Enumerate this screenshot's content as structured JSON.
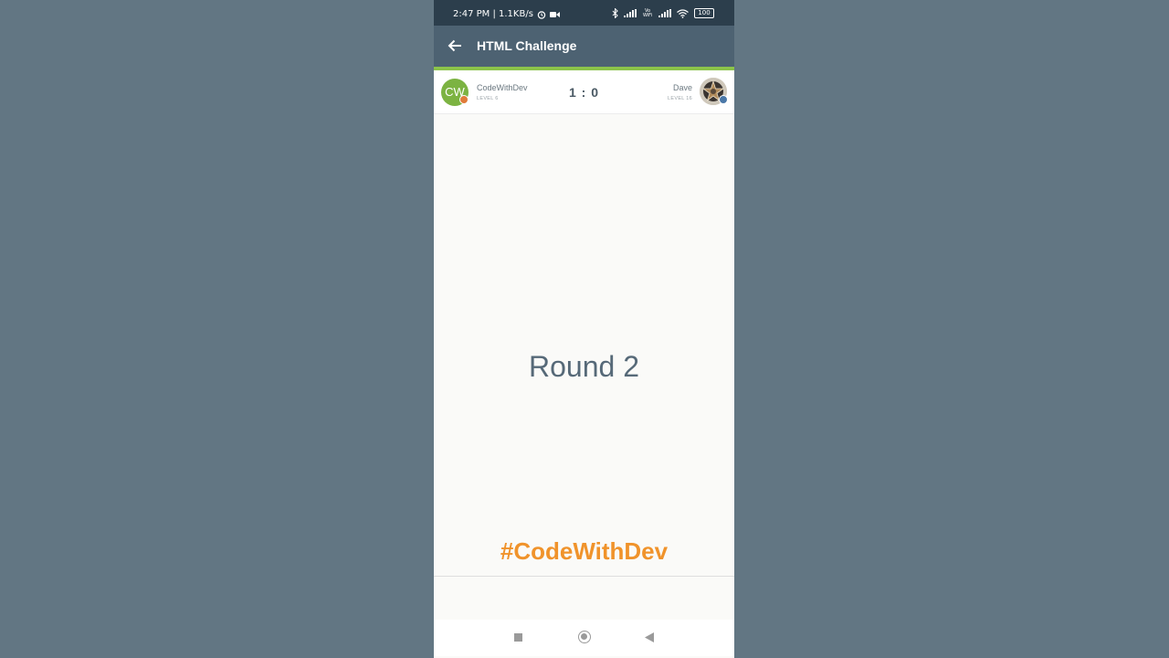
{
  "status_bar": {
    "time_speed": "2:47 PM | 1.1KB/s",
    "battery": "100",
    "network_label": "Vo WiFi"
  },
  "toolbar": {
    "title": "HTML Challenge"
  },
  "match": {
    "player_left": {
      "initials": "CW",
      "name": "CodeWithDev",
      "level": "LEVEL 6"
    },
    "score": "1 : 0",
    "player_right": {
      "name": "Dave",
      "level": "LEVEL 16"
    }
  },
  "round": {
    "label": "Round 2"
  },
  "watermark": {
    "hashtag": "#CodeWithDev"
  },
  "colors": {
    "toolbar": "#4d6272",
    "status_bar": "#2c3e4c",
    "accent": "#8bc34a",
    "hashtag": "#f0932b",
    "avatar_left": "#7cb342"
  },
  "icons": [
    "back-arrow-icon",
    "alarm-icon",
    "video-icon",
    "bluetooth-icon",
    "signal-icon",
    "wifi-icon",
    "battery-icon",
    "recents-icon",
    "home-icon",
    "nav-back-icon"
  ]
}
